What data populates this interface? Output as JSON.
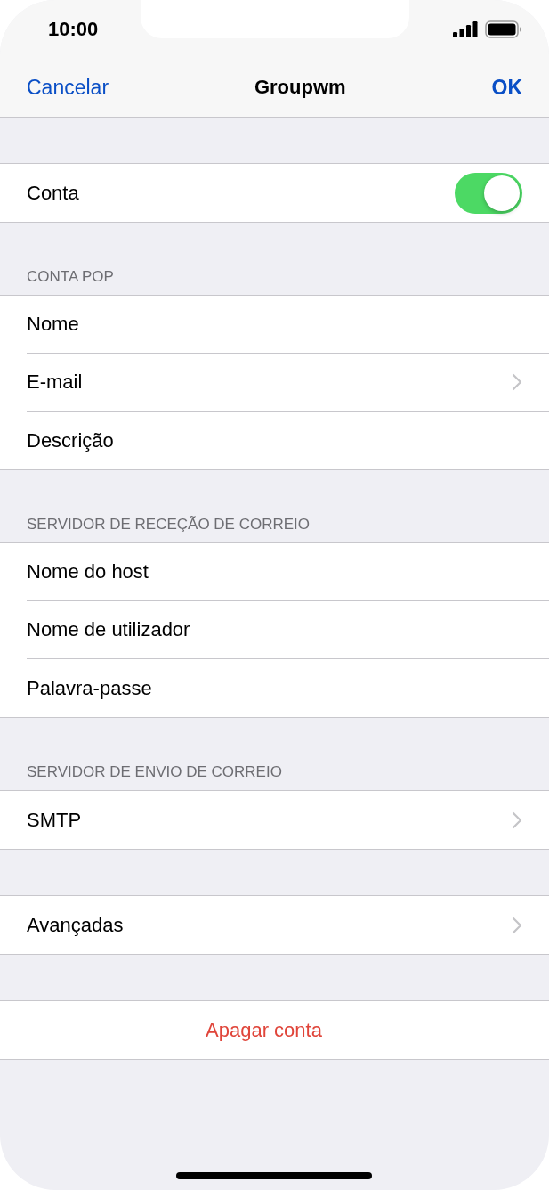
{
  "status_bar": {
    "time": "10:00"
  },
  "nav": {
    "left": "Cancelar",
    "title": "Groupwm",
    "right": "OK"
  },
  "sections": [
    {
      "rows": [
        {
          "kind": "toggle",
          "label": "Conta",
          "on": true
        }
      ]
    },
    {
      "header": "CONTA POP",
      "rows": [
        {
          "kind": "plain",
          "label": "Nome"
        },
        {
          "kind": "disclosure",
          "label": "E-mail"
        },
        {
          "kind": "plain",
          "label": "Descrição"
        }
      ]
    },
    {
      "header": "SERVIDOR DE RECEÇÃO DE CORREIO",
      "rows": [
        {
          "kind": "plain",
          "label": "Nome do host"
        },
        {
          "kind": "plain",
          "label": "Nome de utilizador"
        },
        {
          "kind": "plain",
          "label": "Palavra-passe"
        }
      ]
    },
    {
      "header": "SERVIDOR DE ENVIO DE CORREIO",
      "rows": [
        {
          "kind": "disclosure",
          "label": "SMTP"
        }
      ]
    },
    {
      "rows": [
        {
          "kind": "disclosure",
          "label": "Avançadas"
        }
      ]
    },
    {
      "rows": [
        {
          "kind": "destructive",
          "label": "Apagar conta"
        }
      ]
    }
  ]
}
